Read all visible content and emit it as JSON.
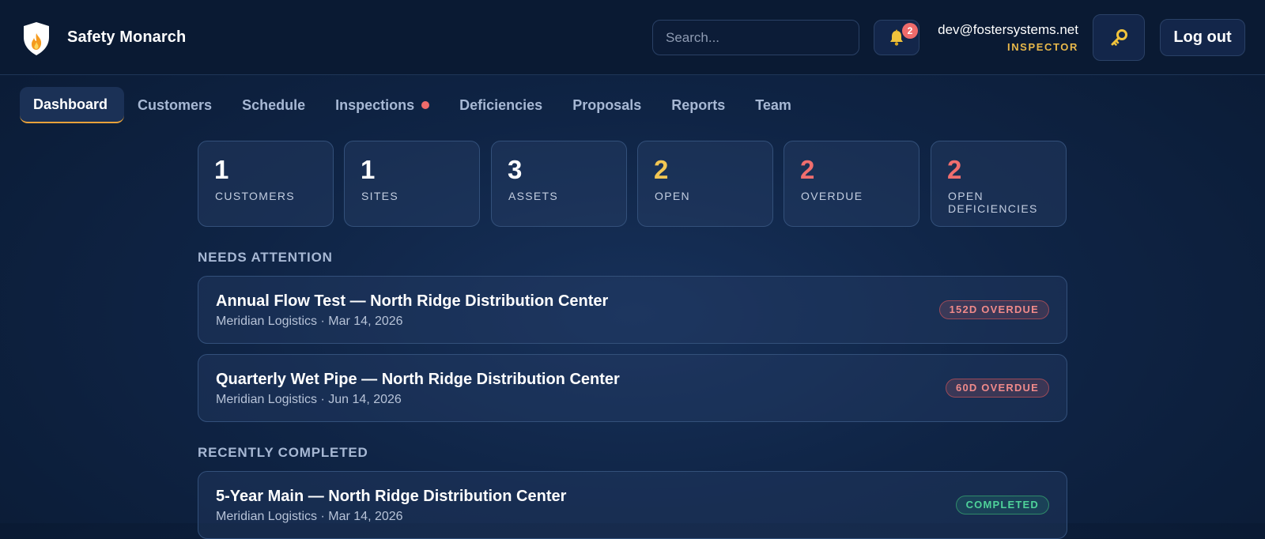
{
  "app": {
    "brand": "Safety Monarch"
  },
  "header": {
    "search_placeholder": "Search...",
    "notifications_count": "2",
    "user_email": "dev@fostersystems.net",
    "user_role": "INSPECTOR",
    "logout_label": "Log out"
  },
  "nav": {
    "items": [
      {
        "label": "Dashboard",
        "active": true
      },
      {
        "label": "Customers"
      },
      {
        "label": "Schedule"
      },
      {
        "label": "Inspections",
        "has_alert_dot": true
      },
      {
        "label": "Deficiencies"
      },
      {
        "label": "Proposals"
      },
      {
        "label": "Reports"
      },
      {
        "label": "Team"
      }
    ]
  },
  "stats": [
    {
      "value": "1",
      "label": "CUSTOMERS",
      "color": "#ffffff"
    },
    {
      "value": "1",
      "label": "SITES",
      "color": "#ffffff"
    },
    {
      "value": "3",
      "label": "ASSETS",
      "color": "#ffffff"
    },
    {
      "value": "2",
      "label": "OPEN",
      "color": "#f2c653"
    },
    {
      "value": "2",
      "label": "OVERDUE",
      "color": "#f06e6e"
    },
    {
      "value": "2",
      "label": "OPEN DEFICIENCIES",
      "color": "#f06e6e"
    }
  ],
  "needs_attention": {
    "title": "NEEDS ATTENTION",
    "items": [
      {
        "title": "Annual Flow Test — North Ridge Distribution Center",
        "subtitle": "Meridian Logistics · Mar 14, 2026",
        "badge": "152D OVERDUE"
      },
      {
        "title": "Quarterly Wet Pipe — North Ridge Distribution Center",
        "subtitle": "Meridian Logistics · Jun 14, 2026",
        "badge": "60D OVERDUE"
      }
    ]
  },
  "recently_completed": {
    "title": "RECENTLY COMPLETED",
    "items": [
      {
        "title": "5-Year Main — North Ridge Distribution Center",
        "subtitle": "Meridian Logistics · Mar 14, 2026",
        "badge": "COMPLETED"
      }
    ]
  },
  "colors": {
    "accent": "#e8a13a",
    "danger": "#ef6b6b",
    "success": "#4fd39a",
    "warning": "#f2c653"
  },
  "icons": {
    "logo": "shield-flame-icon",
    "notifications": "bell-icon",
    "password": "key-icon"
  }
}
